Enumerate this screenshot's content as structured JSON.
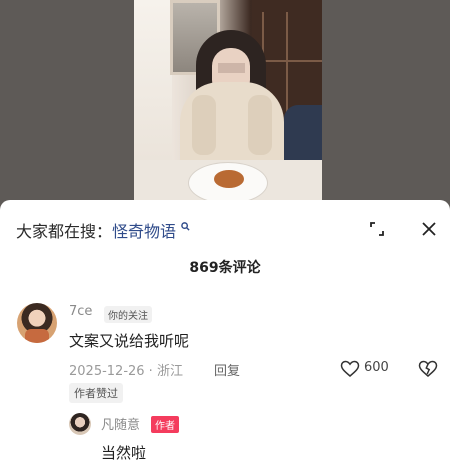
{
  "search": {
    "prefix": "大家都在搜：",
    "term": "怪奇物语",
    "icon": "search-icon"
  },
  "header": {
    "comment_count": "869条评论",
    "expand_icon": "expand-icon",
    "close_icon": "close-icon"
  },
  "comments": [
    {
      "username": "7ce",
      "tag": "你的关注",
      "text": "文案又说给我听呢",
      "date_location": "2025-12-26 · 浙江",
      "reply_label": "回复",
      "likes": "600",
      "author_liked": "作者赞过",
      "replies": [
        {
          "username": "凡随意",
          "tag": "作者",
          "text": "当然啦"
        }
      ]
    }
  ],
  "colors": {
    "search_link": "#2f4b8a",
    "author_tag": "#f43c5d",
    "meta_gray": "#9a9a9a"
  }
}
